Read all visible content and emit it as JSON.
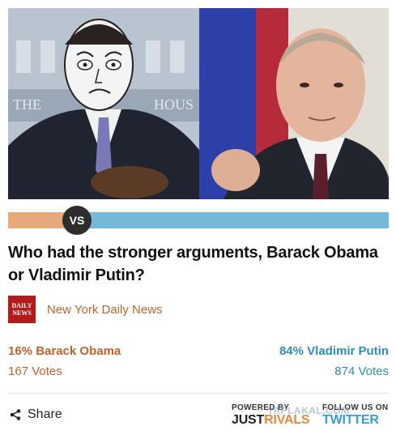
{
  "poll": {
    "question": "Who had the stronger arguments, Barack Obama or Vladimir Putin?",
    "vs_label": "VS",
    "source": {
      "logo_line1": "DAILY",
      "logo_line2": "NEWS",
      "name": "New York Daily News"
    },
    "left": {
      "label": "16% Barack Obama",
      "votes": "167 Votes",
      "percent": 16,
      "color": "#e6a97c"
    },
    "right": {
      "label": "84% Vladimir Putin",
      "votes": "874 Votes",
      "percent": 84,
      "color": "#75b9d6"
    }
  },
  "footer": {
    "share_label": "Share",
    "powered_by": "POWERED BY",
    "brand_just": "JUST",
    "brand_rivals": "RIVALS",
    "follow_us": "FOLLOW US ON",
    "twitter": "TWITTER",
    "watermark": "YAPLAKAL.COM"
  },
  "images": {
    "left_photo": "barack-obama-photo",
    "right_photo": "vladimir-putin-photo"
  }
}
